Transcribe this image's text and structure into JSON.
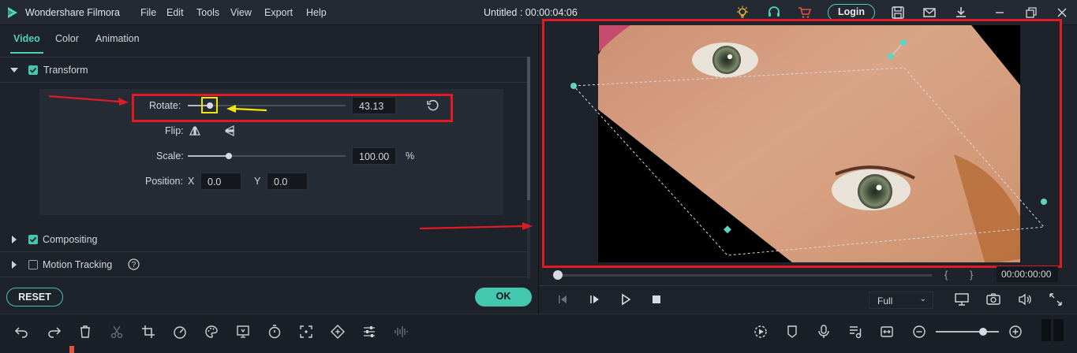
{
  "app": {
    "name": "Wondershare Filmora",
    "project_title": "Untitled : 00:00:04:06"
  },
  "menu": [
    "File",
    "Edit",
    "Tools",
    "View",
    "Export",
    "Help"
  ],
  "header": {
    "login_label": "Login"
  },
  "tabs": [
    {
      "label": "Video",
      "active": true
    },
    {
      "label": "Color",
      "active": false
    },
    {
      "label": "Animation",
      "active": false
    }
  ],
  "transform": {
    "section_label": "Transform",
    "checked": true,
    "rotate_label": "Rotate:",
    "rotate_value": "43.13",
    "rotate_fraction": 0.14,
    "flip_label": "Flip:",
    "scale_label": "Scale:",
    "scale_value": "100.00",
    "scale_fraction": 0.26,
    "scale_unit": "%",
    "position_label": "Position:",
    "x_label": "X",
    "x_value": "0.0",
    "y_label": "Y",
    "y_value": "0.0"
  },
  "compositing": {
    "label": "Compositing",
    "checked": true
  },
  "motion_tracking": {
    "label": "Motion Tracking",
    "checked": false
  },
  "buttons": {
    "reset": "RESET",
    "ok": "OK"
  },
  "preview": {
    "timecode": "00:00:00:00",
    "quality": "Full",
    "playhead_fraction": 0.0,
    "bracket_in": "{",
    "bracket_out": "}"
  },
  "colors": {
    "accent": "#43c7ae",
    "highlight_red": "#e01b24",
    "annotation_yellow": "#f2e600"
  }
}
